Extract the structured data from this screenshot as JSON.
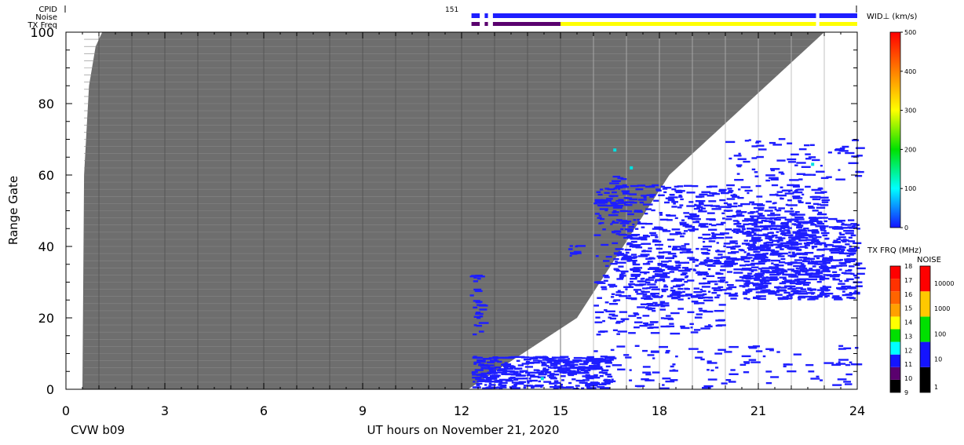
{
  "chart_data": {
    "type": "heatmap",
    "station": "CVW b09",
    "xlabel": "UT hours on November 21, 2020",
    "ylabel": "Range Gate",
    "xlim": [
      0,
      24
    ],
    "ylim": [
      0,
      100
    ],
    "x_ticks": [
      "0",
      "3",
      "6",
      "9",
      "12",
      "15",
      "18",
      "21",
      "24"
    ],
    "y_ticks": [
      "0",
      "20",
      "40",
      "60",
      "80",
      "100"
    ],
    "grid": "vertical lines each hour",
    "header": {
      "row_labels": [
        "CPID",
        "Noise",
        "TX Freq"
      ],
      "cpid_value": "151",
      "cpid_change_hour": 12.0
    },
    "colorbars": [
      {
        "title": "WID⊥ (km/s)",
        "ticks": [
          "0",
          "100",
          "200",
          "300",
          "400",
          "500"
        ],
        "range": [
          0,
          500
        ],
        "colors": [
          "#1414ff",
          "#00ffff",
          "#00e000",
          "#ffff00",
          "#ff8000",
          "#ff0000"
        ]
      },
      {
        "title": "TX FRQ (MHz)",
        "ticks": [
          "9",
          "10",
          "11",
          "12",
          "13",
          "14",
          "15",
          "16",
          "17",
          "18"
        ],
        "colors": [
          "#000000",
          "#5a006e",
          "#1414ff",
          "#00ffff",
          "#00e000",
          "#ffff00",
          "#ffa000",
          "#ff6400",
          "#ff3200",
          "#ff0000"
        ]
      },
      {
        "title": "NOISE",
        "ticks": [
          "1",
          "10",
          "100",
          "1000",
          "10000"
        ],
        "colors": [
          "#000000",
          "#1414ff",
          "#00e000",
          "#ffc800",
          "#ff0000"
        ]
      }
    ],
    "ground_scatter": {
      "color": "#6e6e6e",
      "description_points": [
        {
          "x": 0.5,
          "y": 0
        },
        {
          "x": 0.55,
          "y": 60
        },
        {
          "x": 0.7,
          "y": 85
        },
        {
          "x": 0.9,
          "y": 96
        },
        {
          "x": 1.1,
          "y": 100
        }
      ],
      "end_points": [
        {
          "x": 12.2,
          "y": 0
        },
        {
          "x": 15.5,
          "y": 20
        },
        {
          "x": 18.3,
          "y": 60
        },
        {
          "x": 23.0,
          "y": 100
        }
      ]
    },
    "scatter_color": "#1e1eff"
  }
}
